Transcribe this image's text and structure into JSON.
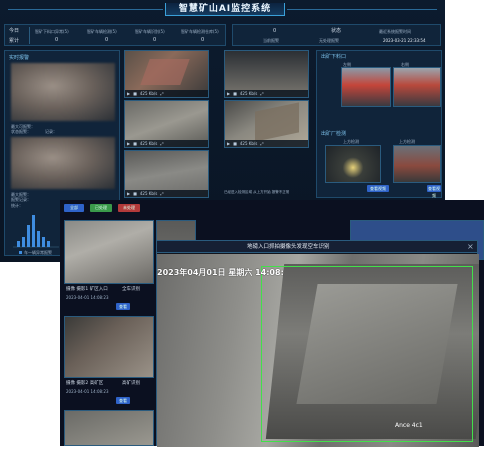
{
  "top_app": {
    "title": "智慧矿山AI监控系统",
    "row1_left_label": "今日",
    "row2_left_label": "累计",
    "stat_labels": [
      "智矿下料口异常(5)",
      "智矿车辆检测(5)",
      "智矿车辆识别(5)",
      "智矿车辆检测仓库(5)"
    ],
    "stat_values": [
      "0",
      "0",
      "0",
      "0"
    ],
    "right_stats": [
      {
        "label": "0",
        "sub": "当前报警"
      },
      {
        "label": "状态",
        "sub": "无处理报警"
      },
      {
        "label": "最近系统报警时间",
        "sub": "2023-03-21 22:33:54"
      }
    ],
    "left_section1": "实时报警",
    "left_section1_meta": [
      "最大可报警：",
      "状态报警：",
      "记录：",
      "数量："
    ],
    "left_section2_meta": [
      "最大报警：",
      "报警记录：",
      "统计：",
      "数量："
    ],
    "histogram_legend": "车一辆异常报警",
    "cam_overlay": "425 Kb/s",
    "right_section1": "出矿下料口",
    "right_section2": "出矿厂检测",
    "right_cap_labels": [
      "左侧",
      "右侧",
      "上方检测",
      "上方检测"
    ],
    "right_btn": "查看视频",
    "mid_text": "已经进入检测区域 从上方开始 报警不正常"
  },
  "bottom_app": {
    "toolbar_buttons": [
      {
        "label": "全部",
        "color": "#2f63c9"
      },
      {
        "label": "已处理",
        "color": "#3a9a4a"
      },
      {
        "label": "未处理",
        "color": "#b23a3a"
      }
    ],
    "cards": [
      {
        "name": "摄像 摄影1 矿区入口",
        "status": "全车识别",
        "time": "2023-04-01 14:08:23"
      },
      {
        "name": "摄像 摄影2 高矿区",
        "status": "高矿识别",
        "time": "2023-04-01 14:08:23"
      },
      {
        "name": "摄像 摄影3 矿区3",
        "status": "未处理",
        "time": "2023-04-01 14:08:23"
      }
    ],
    "card_btn": "查看",
    "modal_title": "地磅入口抓拍摄像头发现空车识别",
    "modal_timestamp": "2023年04月01日 星期六 14:08:",
    "modal_watermark": "Ance 4c1",
    "close_glyph": "×"
  }
}
